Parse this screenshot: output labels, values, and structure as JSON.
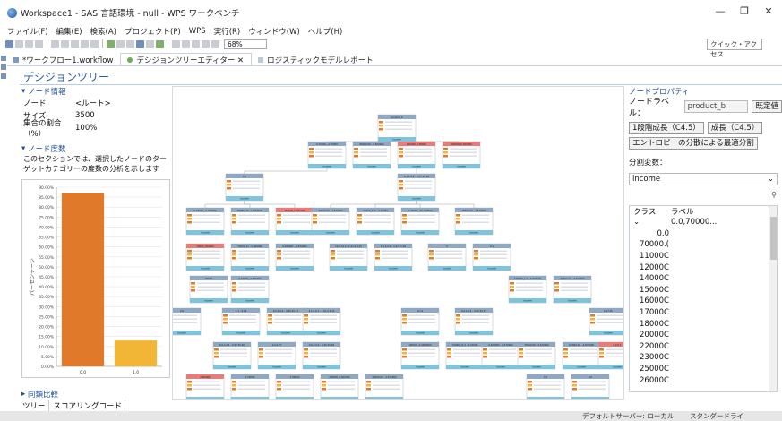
{
  "window": {
    "title": "Workspace1 - SAS 言語環境 - null - WPS ワークベンチ",
    "controls": [
      "—",
      "❐",
      "✕"
    ]
  },
  "menu": [
    "ファイル(F)",
    "編集(E)",
    "検索(A)",
    "プロジェクト(P)",
    "WPS",
    "実行(R)",
    "ウィンドウ(W)",
    "ヘルプ(H)"
  ],
  "toolbar": {
    "zoom": "68%",
    "quick_access": "クイック・アクセス"
  },
  "tabs": [
    {
      "label": "*ワークフロー1.workflow"
    },
    {
      "label": "デシジョンツリーエディター ✕"
    },
    {
      "label": "ロジスティックモデルレポート"
    }
  ],
  "editor_title": "デシジョンツリー",
  "node_info": {
    "heading": "ノード情報",
    "rows": [
      {
        "key": "ノード",
        "value": "<ルート>"
      },
      {
        "key": "サイズ",
        "value": "3500"
      },
      {
        "key": "集合の割合（%）",
        "value": "100%"
      }
    ]
  },
  "node_freq": {
    "heading": "ノード度数",
    "description": "このセクションでは、選択したノードのターゲットカテゴリーの度数の分析を示します"
  },
  "chart_data": {
    "type": "bar",
    "categories": [
      "0.0",
      "1.0"
    ],
    "values": [
      87,
      13
    ],
    "ylim": [
      0,
      90
    ],
    "ytick_labels": [
      "0.00%",
      "5.00%",
      "10.00%",
      "15.00%",
      "20.00%",
      "25.00%",
      "30.00%",
      "35.00%",
      "40.00%",
      "45.00%",
      "50.00%",
      "55.00%",
      "60.00%",
      "65.00%",
      "70.00%",
      "75.00%",
      "80.00%",
      "85.00%",
      "90.00%"
    ],
    "ylabel": "パーセンテージ",
    "colors": [
      "#e07a2a",
      "#f2b637"
    ]
  },
  "compare": {
    "heading": "同類比較"
  },
  "bottom_tabs": [
    "ツリー",
    "スコアリングコード"
  ],
  "node_props": {
    "heading": "ノードプロパティ",
    "label_caption": "ノードラベル：",
    "label_value": "product_b",
    "default_btn": "既定値",
    "grow_one": "1段階成長（C4.5）",
    "grow": "成長（C4.5）",
    "entropy_btn": "エントロピーの分散による最適分割",
    "split_caption": "分割変数：",
    "split_var": "income",
    "table_headers": [
      "クラス",
      "ラベル"
    ],
    "table_subheader": "0.0,70000...",
    "classes": [
      "0.0",
      "70000.(",
      "11000C",
      "12000C",
      "14000C",
      "15000C",
      "16000C",
      "17000C",
      "18000C",
      "20000C",
      "22000C",
      "23000C",
      "25000C",
      "26000C"
    ]
  },
  "status": {
    "left": "デフォルトサーバー: ローカル",
    "right": "スタンダードライ"
  },
  "tree": {
    "root": {
      "title": "product_b",
      "sub": "income"
    },
    "level1": [
      "0.70000_-4.70000",
      "80000.00 - 0.500000",
      "110000_0.00000",
      "150000_0.400000"
    ],
    "level2": [
      "0.0",
      "0.1,1,0.4 - 0.57.25.00"
    ],
    "level3": [
      "0.70000_-4.700000",
      "70000_90.-1.0400000",
      "150000_0.400000",
      "40000.00 - 4.670000",
      "70000_270 - 0.20000",
      "0.70000_-90.700000",
      "28000.00 - 4.670000"
    ],
    "level4": [
      "70000_200000",
      "70000_21 - 0.400000",
      "0.000001 - 4.670000",
      "1S.0.74.0 - 1.51.2.4.25",
      "0.1.4.0.0 - 3.27.25.00",
      "0",
      "0.1"
    ],
    "level5": [
      "70000",
      "0.70000_-4.600000",
      "150000_1.0 - 0.470000",
      "35000.00 - 4.670000"
    ],
    "level6": [
      "2.0",
      "4.1 - 4.09",
      "0.0,1,0.4 - 4.25.25.27",
      "4.1,0.0.1 - 1.51.2.4.25",
      "0.1.0",
      "0.0,1,0.4 - 4.25.25.27",
      "0.27.25"
    ],
    "level7": [
      "0.0,1,0.4 - 0.57.25.00",
      "2.0.4.27",
      "0.0.4.0.0 - 4.25.25.00",
      "160000_0.4000000",
      "70000_21.0 - 0.47000",
      "0.400000 - 0.470000",
      "35000.00 - 4.670000",
      "0.0000.00 - 4.870000",
      "0.0.0.1"
    ],
    "level8": [
      "2300000",
      "0.70000",
      "3.00000",
      "400000_0.400000",
      "40000.00 - 4.670000",
      "0.0",
      "0.0"
    ]
  }
}
